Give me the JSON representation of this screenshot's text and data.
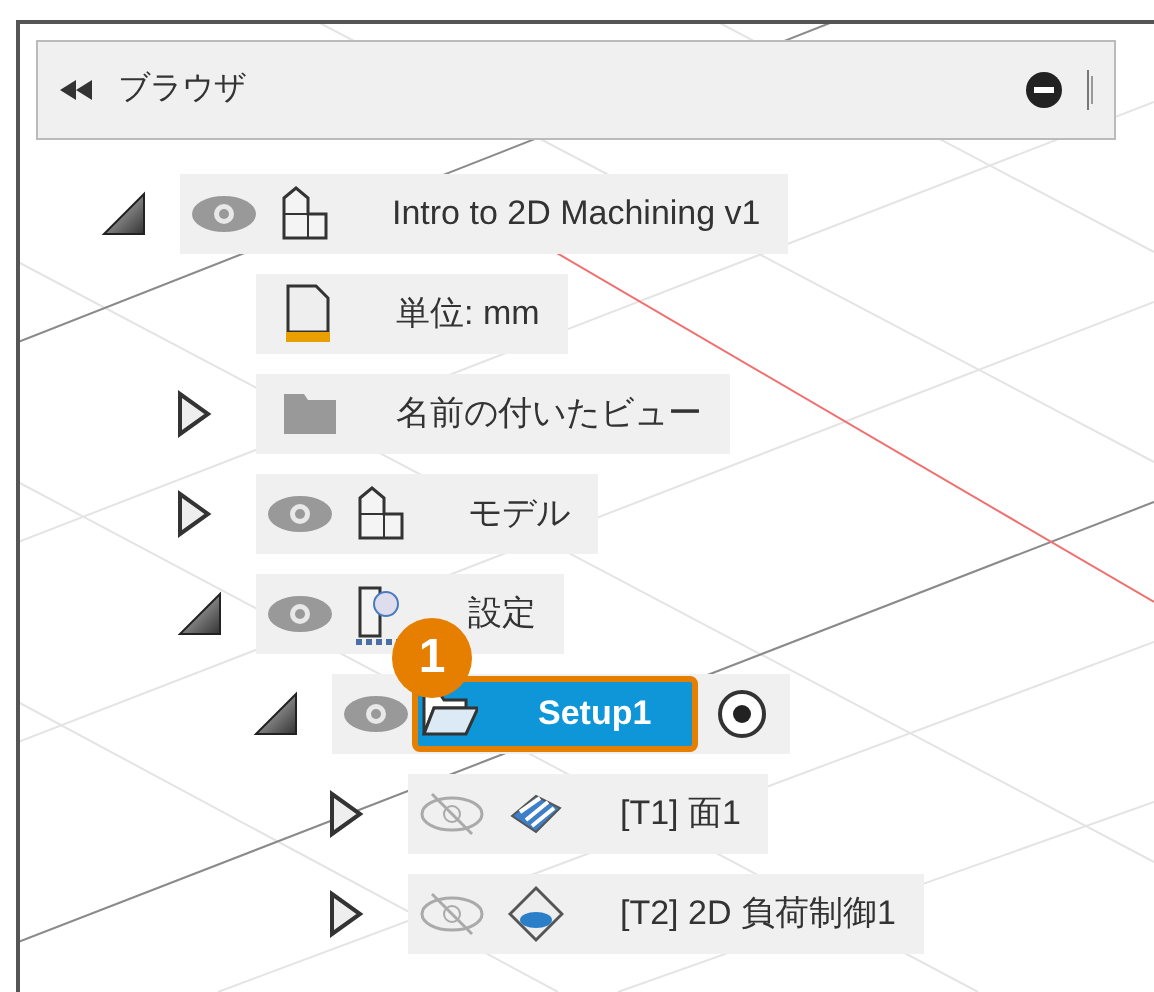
{
  "panel": {
    "title": "ブラウザ"
  },
  "tree": [
    {
      "label": "Intro to 2D Machining v1",
      "expanded": true,
      "visible": true,
      "kind": "component",
      "children": [
        {
          "label": "単位: mm",
          "kind": "units"
        },
        {
          "label": "名前の付いたビュー",
          "expanded": false,
          "kind": "folder"
        },
        {
          "label": "モデル",
          "expanded": false,
          "visible": true,
          "kind": "component"
        },
        {
          "label": "設定",
          "expanded": true,
          "visible": true,
          "kind": "setups",
          "children": [
            {
              "label": "Setup1",
              "expanded": true,
              "visible": true,
              "kind": "setup",
              "selected": true,
              "active": true,
              "callout": "1",
              "children": [
                {
                  "label": "[T1] 面1",
                  "expanded": false,
                  "visible": false,
                  "kind": "face",
                  "selected": false
                },
                {
                  "label": "[T2] 2D 負荷制御1",
                  "expanded": false,
                  "visible": false,
                  "kind": "adaptive",
                  "selected": false
                }
              ]
            }
          ]
        }
      ]
    }
  ]
}
